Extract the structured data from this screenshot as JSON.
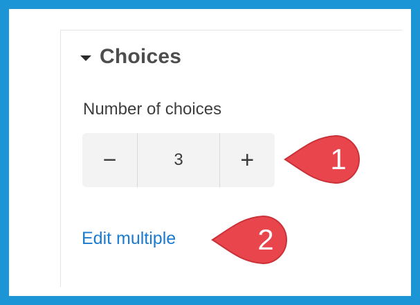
{
  "section": {
    "title": "Choices",
    "caret_icon": "caret-down-icon"
  },
  "field": {
    "label": "Number of choices"
  },
  "stepper": {
    "decrement_label": "−",
    "value": "3",
    "increment_label": "+"
  },
  "link": {
    "edit_multiple_label": "Edit multiple"
  },
  "callouts": {
    "first": "1",
    "second": "2",
    "color": "#e8454c"
  },
  "colors": {
    "frame_border": "#1b95d6",
    "link": "#1a7bd0"
  }
}
